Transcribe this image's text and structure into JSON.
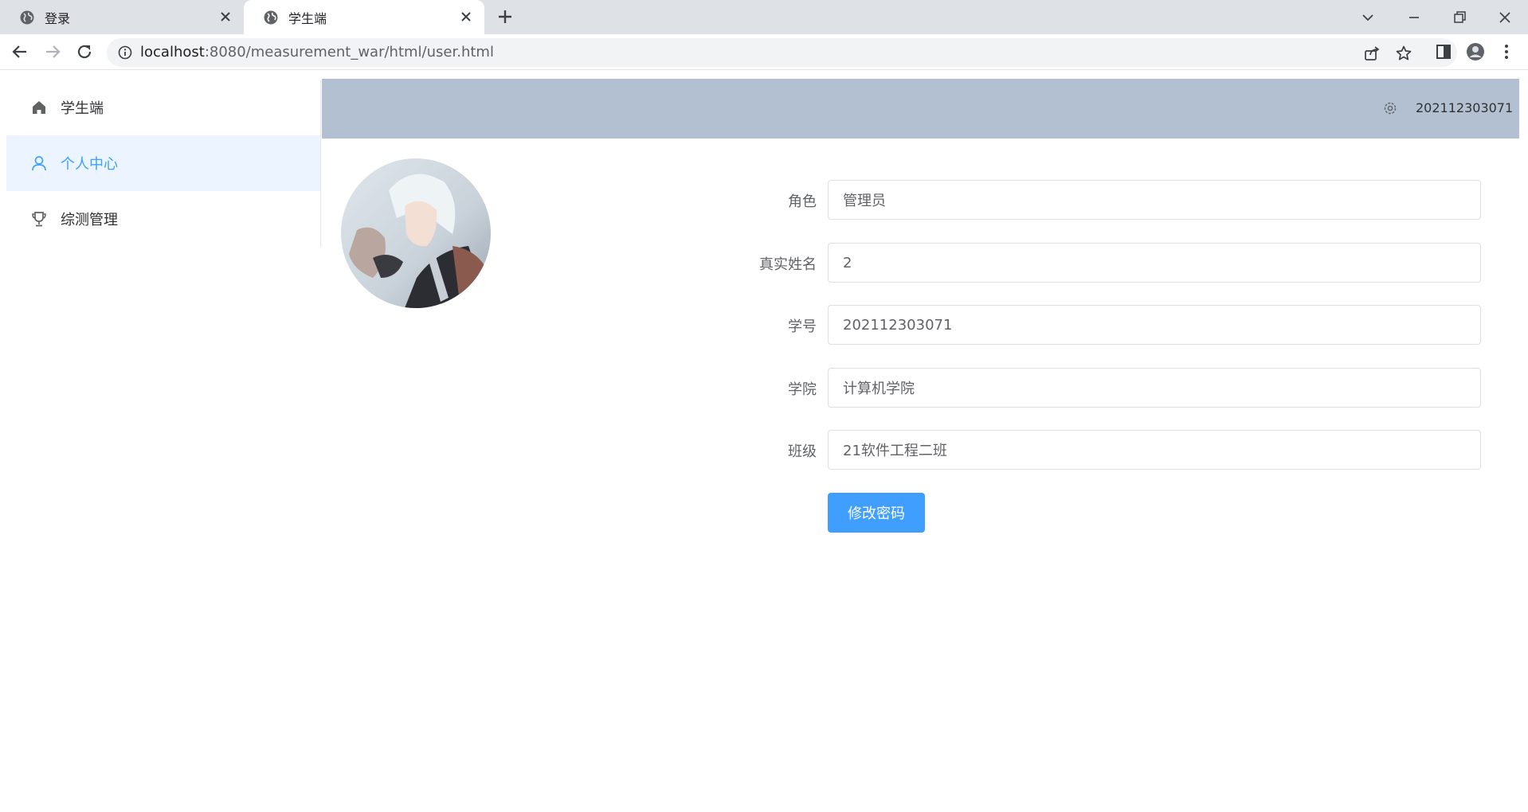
{
  "browser": {
    "tabs": [
      {
        "title": "登录"
      },
      {
        "title": "学生端"
      }
    ],
    "url_host": "localhost",
    "url_rest": ":8080/measurement_war/html/user.html"
  },
  "sidebar": {
    "items": [
      {
        "label": "学生端",
        "icon": "home-icon"
      },
      {
        "label": "个人中心",
        "icon": "user-icon",
        "active": true
      },
      {
        "label": "综测管理",
        "icon": "trophy-icon"
      }
    ]
  },
  "header": {
    "username": "202112303071"
  },
  "profile": {
    "fields": [
      {
        "label": "角色",
        "value": "管理员"
      },
      {
        "label": "真实姓名",
        "value": "2"
      },
      {
        "label": "学号",
        "value": "202112303071"
      },
      {
        "label": "学院",
        "value": "计算机学院"
      },
      {
        "label": "班级",
        "value": "21软件工程二班"
      }
    ],
    "change_password_label": "修改密码"
  },
  "colors": {
    "accent": "#409eff",
    "header_bg": "#b3c0d1",
    "active_menu_bg": "#ecf5ff"
  }
}
